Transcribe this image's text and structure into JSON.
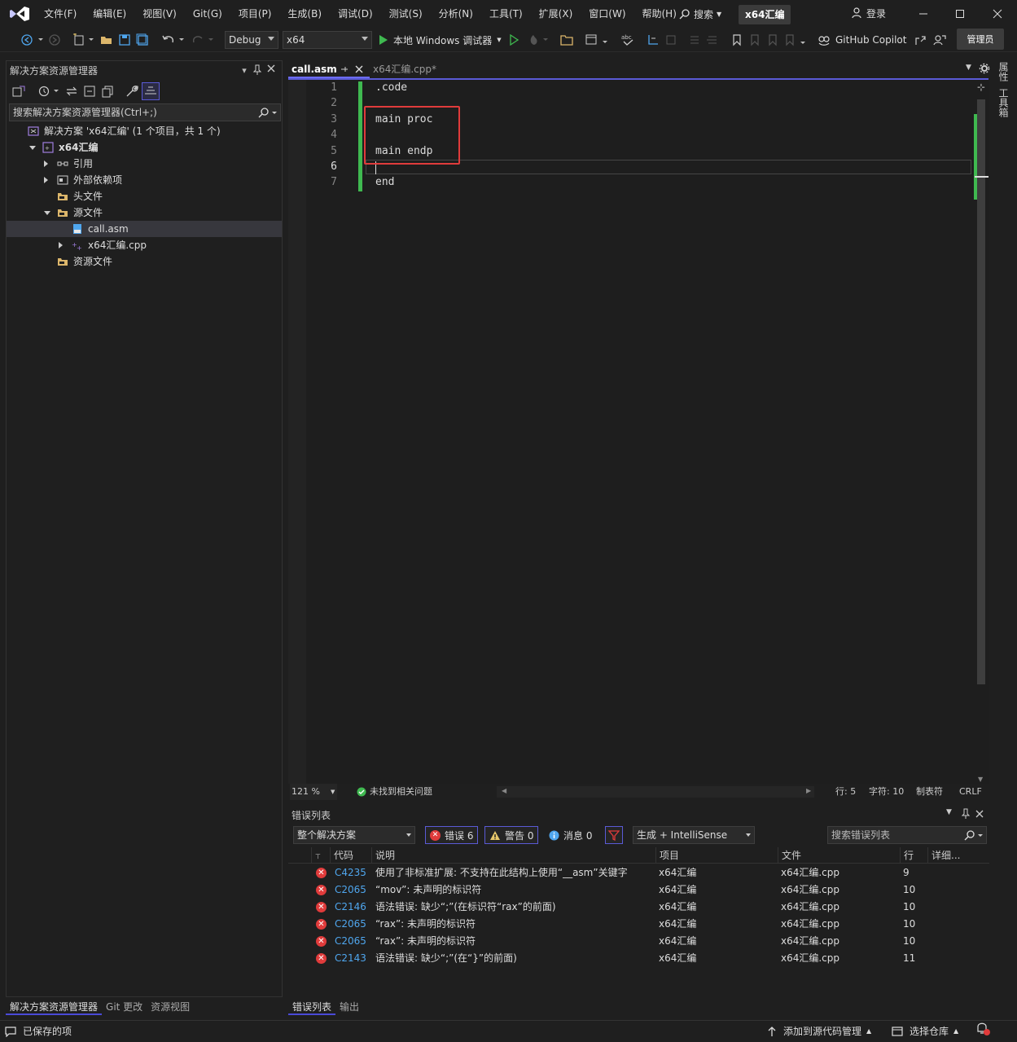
{
  "menu": [
    "文件(F)",
    "编辑(E)",
    "视图(V)",
    "Git(G)",
    "项目(P)",
    "生成(B)",
    "调试(D)",
    "测试(S)",
    "分析(N)",
    "工具(T)",
    "扩展(X)",
    "窗口(W)",
    "帮助(H)"
  ],
  "title_search": "搜索",
  "project_name": "x64汇编",
  "login": "登录",
  "toolbar": {
    "config": "Debug",
    "platform": "x64",
    "run_label": "本地 Windows 调试器",
    "copilot": "GitHub Copilot",
    "admin": "管理员"
  },
  "solution_explorer": {
    "title": "解决方案资源管理器",
    "search_placeholder": "搜索解决方案资源管理器(Ctrl+;)",
    "tree": [
      {
        "label": "解决方案 'x64汇编' (1 个项目，共 1 个)",
        "level": 0,
        "twisty": "none",
        "icon": "solution-icon"
      },
      {
        "label": "x64汇编",
        "level": 1,
        "twisty": "open",
        "icon": "project-icon",
        "bold": true
      },
      {
        "label": "引用",
        "level": 2,
        "twisty": "closed",
        "icon": "references-icon"
      },
      {
        "label": "外部依赖项",
        "level": 2,
        "twisty": "closed",
        "icon": "external-deps-icon"
      },
      {
        "label": "头文件",
        "level": 2,
        "twisty": "none",
        "icon": "folder-filter-icon"
      },
      {
        "label": "源文件",
        "level": 2,
        "twisty": "open",
        "icon": "folder-filter-icon"
      },
      {
        "label": "call.asm",
        "level": 3,
        "twisty": "none",
        "icon": "asm-file-icon",
        "selected": true
      },
      {
        "label": "x64汇编.cpp",
        "level": 3,
        "twisty": "closed",
        "icon": "cpp-file-icon"
      },
      {
        "label": "资源文件",
        "level": 2,
        "twisty": "none",
        "icon": "folder-filter-icon"
      }
    ],
    "bottom_tabs": [
      "解决方案资源管理器",
      "Git 更改",
      "资源视图"
    ]
  },
  "editor": {
    "tabs": [
      {
        "label": "call.asm",
        "active": true
      },
      {
        "label": "x64汇编.cpp*",
        "active": false
      }
    ],
    "lines": [
      ".code",
      "",
      "main proc",
      "",
      "main endp",
      "",
      "end"
    ],
    "current_line": 6,
    "zoom": "121 %",
    "issues": "未找到相关问题",
    "row": "行: 5",
    "col": "字符: 10",
    "indent": "制表符",
    "eol": "CRLF"
  },
  "error_list": {
    "title": "错误列表",
    "scope": "整个解决方案",
    "errors_btn": "错误 6",
    "warnings_btn": "警告 0",
    "messages_btn": "消息 0",
    "build_filter": "生成 + IntelliSense",
    "search_placeholder": "搜索错误列表",
    "columns": [
      "代码",
      "说明",
      "项目",
      "文件",
      "行",
      "详细..."
    ],
    "rows": [
      {
        "code": "C4235",
        "desc": "使用了非标准扩展: 不支持在此结构上使用“__asm”关键字",
        "project": "x64汇编",
        "file": "x64汇编.cpp",
        "line": "9"
      },
      {
        "code": "C2065",
        "desc": "“mov”: 未声明的标识符",
        "project": "x64汇编",
        "file": "x64汇编.cpp",
        "line": "10"
      },
      {
        "code": "C2146",
        "desc": "语法错误: 缺少“;”(在标识符“rax”的前面)",
        "project": "x64汇编",
        "file": "x64汇编.cpp",
        "line": "10"
      },
      {
        "code": "C2065",
        "desc": "“rax”: 未声明的标识符",
        "project": "x64汇编",
        "file": "x64汇编.cpp",
        "line": "10"
      },
      {
        "code": "C2065",
        "desc": "“rax”: 未声明的标识符",
        "project": "x64汇编",
        "file": "x64汇编.cpp",
        "line": "10"
      },
      {
        "code": "C2143",
        "desc": "语法错误: 缺少“;”(在“}”的前面)",
        "project": "x64汇编",
        "file": "x64汇编.cpp",
        "line": "11"
      }
    ],
    "bottom_tabs": [
      "错误列表",
      "输出"
    ]
  },
  "right_rail": [
    "属性",
    "工具箱"
  ],
  "statusbar": {
    "saved": "已保存的项",
    "add_source": "添加到源代码管理",
    "select_repo": "选择仓库"
  },
  "colors": {
    "accent": "#5a5ad6",
    "error": "#e03b3b",
    "change_bar": "#3fb950",
    "link": "#4fa6ee"
  }
}
